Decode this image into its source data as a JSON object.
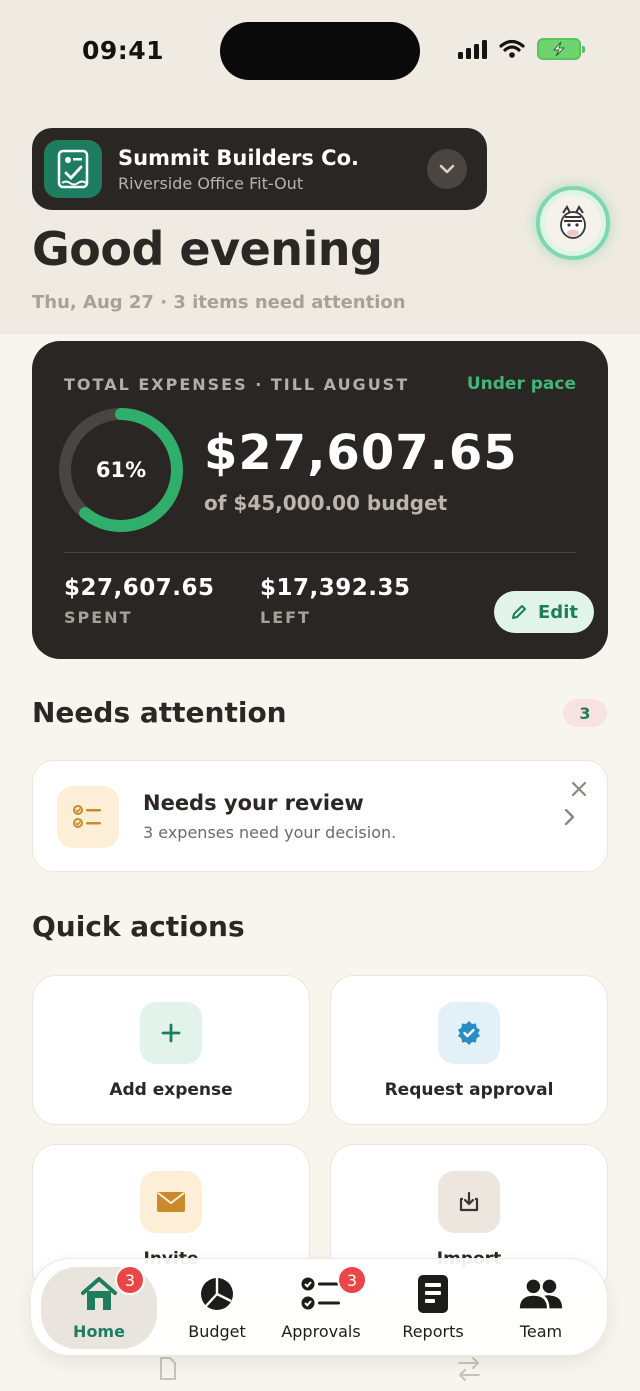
{
  "status_bar": {
    "time": "09:41"
  },
  "project": {
    "name": "Summit Builders Co.",
    "subtitle": "Riverside Office Fit-Out"
  },
  "greeting": "Good evening",
  "subline": "Thu, Aug 27 · 3 items need attention",
  "expenses": {
    "label": "TOTAL EXPENSES · TILL AUGUST",
    "pace": "Under pace",
    "percent": "61%",
    "percent_value": 61,
    "total": "$27,607.65",
    "budget_text": "of $45,000.00 budget",
    "spent_value": "$27,607.65",
    "spent_label": "SPENT",
    "left_value": "$17,392.35",
    "left_label": "LEFT",
    "edit_label": "Edit"
  },
  "needs_attention": {
    "title": "Needs attention",
    "count": "3",
    "card": {
      "title": "Needs your review",
      "description": "3 expenses need your decision."
    }
  },
  "quick_actions": {
    "title": "Quick actions",
    "items": [
      {
        "label": "Add expense",
        "icon": "plus-icon"
      },
      {
        "label": "Request approval",
        "icon": "verified-badge-icon"
      },
      {
        "label": "Invite",
        "icon": "envelope-icon"
      },
      {
        "label": "Import",
        "icon": "import-icon"
      }
    ]
  },
  "tabbar": {
    "items": [
      {
        "label": "Home",
        "badge": "3"
      },
      {
        "label": "Budget"
      },
      {
        "label": "Approvals",
        "badge": "3"
      },
      {
        "label": "Reports"
      },
      {
        "label": "Team"
      }
    ]
  },
  "colors": {
    "accent_green": "#1f7d5f",
    "ring_green": "#3fb77a",
    "dark_card": "#2a2623",
    "badge_red": "#e94747"
  }
}
